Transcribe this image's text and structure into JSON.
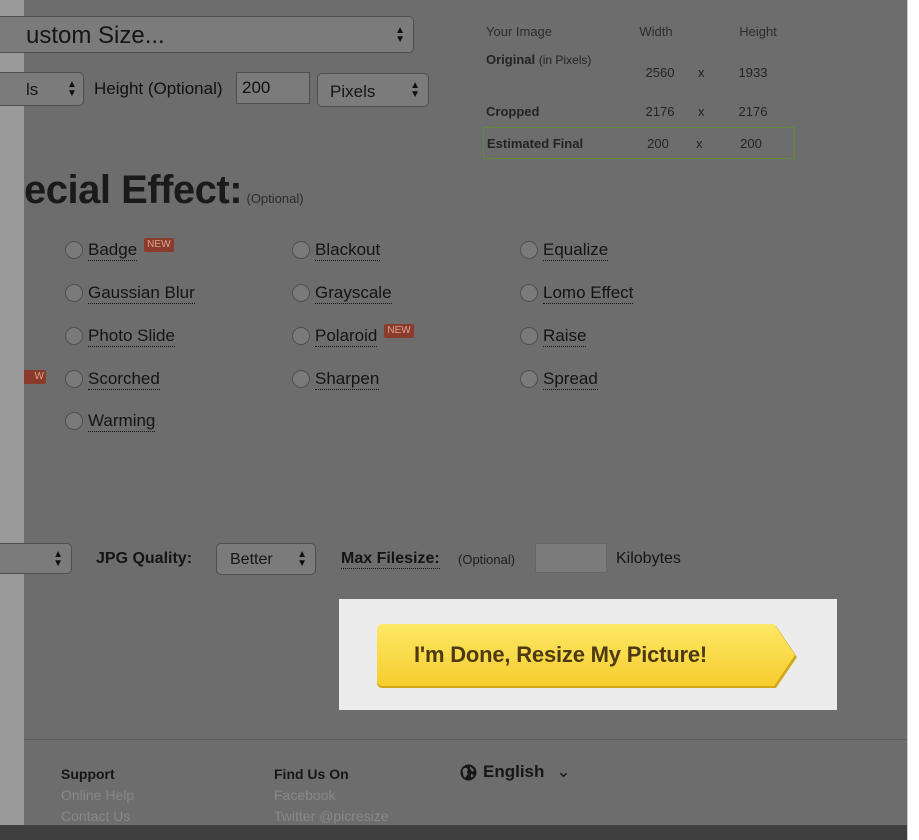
{
  "size_controls": {
    "preset_value": "ustom Size...",
    "width_unit_partial": "ls",
    "height_label": "Height (Optional)",
    "height_value": "200",
    "height_unit": "Pixels"
  },
  "image_table": {
    "headers": {
      "label": "Your Image",
      "width": "Width",
      "height": "Height"
    },
    "original": {
      "label": "Original",
      "label_note": "(in Pixels)",
      "width": "2560",
      "x": "x",
      "height": "1933"
    },
    "cropped": {
      "label": "Cropped",
      "width": "2176",
      "x": "x",
      "height": "2176"
    },
    "estimated_final": {
      "label": "Estimated Final",
      "width": "200",
      "x": "x",
      "height": "200"
    }
  },
  "special_effect": {
    "heading": "ecial Effect:",
    "optional_note": "(Optional)",
    "new_badge_text": "NEW",
    "edge_badge_text": "W",
    "effects": [
      {
        "label": "Badge",
        "new": true
      },
      {
        "label": "Blackout",
        "new": false
      },
      {
        "label": "Equalize",
        "new": false
      },
      {
        "label": "Gaussian Blur",
        "new": false
      },
      {
        "label": "Grayscale",
        "new": false
      },
      {
        "label": "Lomo Effect",
        "new": false
      },
      {
        "label": "Photo Slide",
        "new": false
      },
      {
        "label": "Polaroid",
        "new": true
      },
      {
        "label": "Raise",
        "new": false
      },
      {
        "label": "Scorched",
        "new": false
      },
      {
        "label": "Sharpen",
        "new": false
      },
      {
        "label": "Spread",
        "new": false
      },
      {
        "label": "Warming",
        "new": false
      }
    ]
  },
  "output": {
    "jpg_quality_label": "JPG Quality:",
    "jpg_quality_value": "Better",
    "max_filesize_label": "Max Filesize:",
    "max_filesize_note": "(Optional)",
    "max_filesize_value": "",
    "unit": "Kilobytes"
  },
  "submit": {
    "label": "I'm Done, Resize My Picture!"
  },
  "footer": {
    "support": {
      "heading": "Support",
      "links": [
        "Online Help",
        "Contact Us"
      ]
    },
    "find_us": {
      "heading": "Find Us On",
      "links": [
        "Facebook",
        "Twitter @picresize"
      ]
    },
    "language": {
      "label": "English",
      "icon": "globe-icon"
    }
  },
  "colors": {
    "button_yellow": "#f9d94a",
    "button_text": "#4e3a12",
    "final_row_border": "#5e8a3c",
    "new_badge": "#8b3b2b"
  }
}
